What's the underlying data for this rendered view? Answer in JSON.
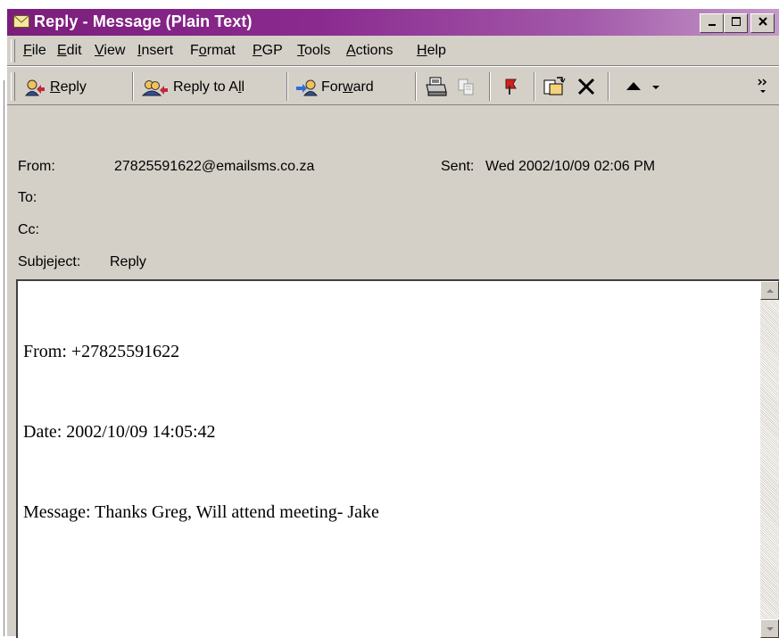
{
  "window": {
    "title": "Reply - Message (Plain Text)"
  },
  "menu": {
    "items": [
      {
        "pre": "",
        "key": "F",
        "post": "ile"
      },
      {
        "pre": "",
        "key": "E",
        "post": "dit"
      },
      {
        "pre": "",
        "key": "V",
        "post": "iew"
      },
      {
        "pre": "",
        "key": "I",
        "post": "nsert"
      },
      {
        "pre": "F",
        "key": "o",
        "post": "rmat"
      },
      {
        "pre": "",
        "key": "P",
        "post": "GP"
      },
      {
        "pre": "",
        "key": "T",
        "post": "ools"
      },
      {
        "pre": "",
        "key": "A",
        "post": "ctions"
      },
      {
        "pre": "",
        "key": "H",
        "post": "elp"
      }
    ]
  },
  "toolbar": {
    "reply": {
      "pre": "",
      "key": "R",
      "post": "eply"
    },
    "reply_all": {
      "pre": "Reply to A",
      "key": "l",
      "post": "l"
    },
    "forward": {
      "pre": "For",
      "key": "w",
      "post": "ard"
    },
    "icons": [
      "print-icon",
      "copy-icon",
      "flag-icon",
      "move-to-folder-icon",
      "delete-icon",
      "previous-item-icon",
      "toolbar-options-icon"
    ]
  },
  "header": {
    "from_label": "From:",
    "from_value": "27825591622@emailsms.co.za",
    "sent_label": "Sent:",
    "sent_value": "Wed 2002/10/09 02:06 PM",
    "to_label": "To:",
    "cc_label": "Cc:",
    "subject_label_pre": "Subje",
    "subject_label_key": "j",
    "subject_label_post": "ect:",
    "subject_value": "Reply"
  },
  "body": {
    "lines": [
      "From: +27825591622",
      "Date: 2002/10/09 14:05:42",
      "Message: Thanks Greg, Will attend meeting- Jake"
    ]
  },
  "colors": {
    "titlebar_start": "#7b1e7b",
    "titlebar_end": "#c59ac8",
    "chrome": "#d4d0c8"
  }
}
